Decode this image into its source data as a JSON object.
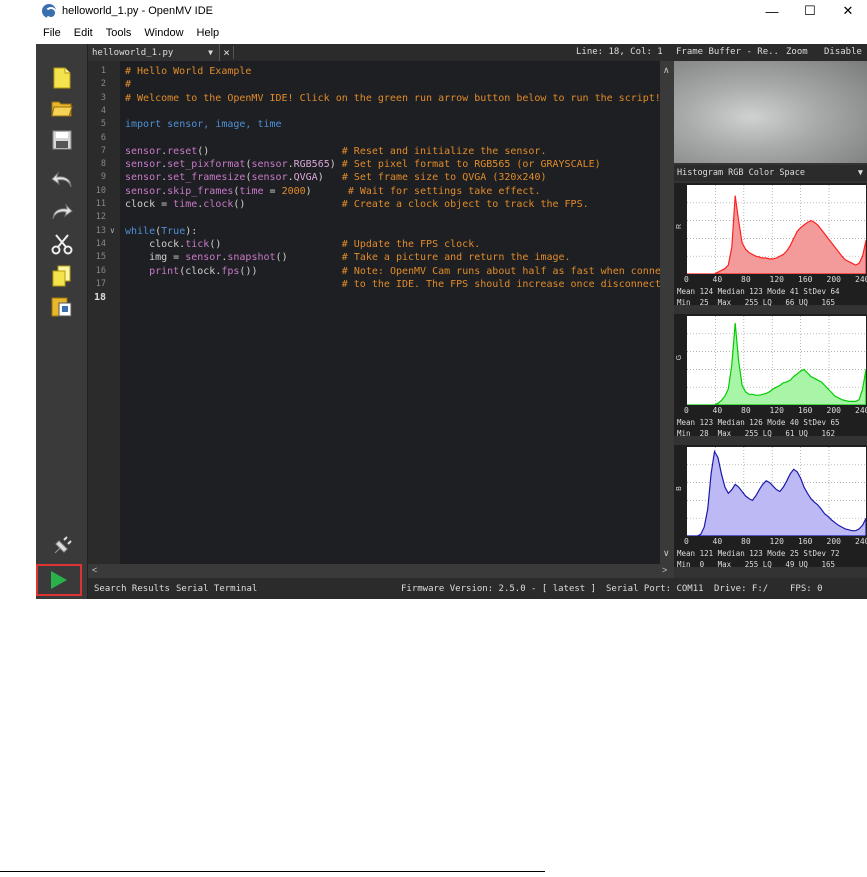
{
  "window": {
    "title": "helloworld_1.py - OpenMV IDE",
    "minimize": "—",
    "maximize": "☐",
    "close": "✕"
  },
  "menu": [
    "File",
    "Edit",
    "Tools",
    "Window",
    "Help"
  ],
  "tabbar": {
    "file_tab": "helloworld_1.py",
    "close": "×",
    "line_col": "Line: 18, Col: 1",
    "frame_buffer": "Frame Buffer - Re..",
    "zoom": "Zoom",
    "disable": "Disable"
  },
  "toolbar": {
    "icons": [
      "new-file-icon",
      "open-folder-icon",
      "save-icon",
      "undo-icon",
      "redo-icon",
      "cut-icon",
      "copy-icon",
      "paste-icon",
      "connect-icon",
      "run-icon"
    ]
  },
  "editor": {
    "line_numbers": [
      "1",
      "2",
      "3",
      "4",
      "5",
      "6",
      "7",
      "8",
      "9",
      "10",
      "11",
      "12",
      "13",
      "14",
      "15",
      "16",
      "17",
      "18"
    ],
    "lines": [
      [
        {
          "t": "# Hello World Example",
          "c": "cmt"
        }
      ],
      [
        {
          "t": "#",
          "c": "cmt"
        }
      ],
      [
        {
          "t": "# Welcome to the OpenMV IDE! Click on the green run arrow button below to run the script!",
          "c": "cmt"
        }
      ],
      [],
      [
        {
          "t": "import ",
          "c": "kw"
        },
        {
          "t": "sensor, image, time",
          "c": "kw"
        }
      ],
      [],
      [
        {
          "t": "sensor",
          "c": "fn"
        },
        {
          "t": ".",
          "c": ""
        },
        {
          "t": "reset",
          "c": "fn"
        },
        {
          "t": "()                      ",
          "c": ""
        },
        {
          "t": "# Reset and initialize the sensor.",
          "c": "cmt"
        }
      ],
      [
        {
          "t": "sensor",
          "c": "fn"
        },
        {
          "t": ".",
          "c": ""
        },
        {
          "t": "set_pixformat",
          "c": "fn"
        },
        {
          "t": "(",
          "c": ""
        },
        {
          "t": "sensor",
          "c": "fn"
        },
        {
          "t": ".",
          "c": ""
        },
        {
          "t": "RGB565",
          "c": "cls"
        },
        {
          "t": ") ",
          "c": ""
        },
        {
          "t": "# Set pixel format to RGB565 (or GRAYSCALE)",
          "c": "cmt"
        }
      ],
      [
        {
          "t": "sensor",
          "c": "fn"
        },
        {
          "t": ".",
          "c": ""
        },
        {
          "t": "set_framesize",
          "c": "fn"
        },
        {
          "t": "(",
          "c": ""
        },
        {
          "t": "sensor",
          "c": "fn"
        },
        {
          "t": ".",
          "c": ""
        },
        {
          "t": "QVGA",
          "c": "cls"
        },
        {
          "t": ")   ",
          "c": ""
        },
        {
          "t": "# Set frame size to QVGA (320x240)",
          "c": "cmt"
        }
      ],
      [
        {
          "t": "sensor",
          "c": "fn"
        },
        {
          "t": ".",
          "c": ""
        },
        {
          "t": "skip_frames",
          "c": "fn"
        },
        {
          "t": "(",
          "c": ""
        },
        {
          "t": "time",
          "c": "fn"
        },
        {
          "t": " = ",
          "c": ""
        },
        {
          "t": "2000",
          "c": "num"
        },
        {
          "t": ")      ",
          "c": ""
        },
        {
          "t": "# Wait for settings take effect.",
          "c": "cmt"
        }
      ],
      [
        {
          "t": "clock = ",
          "c": ""
        },
        {
          "t": "time",
          "c": "fn"
        },
        {
          "t": ".",
          "c": ""
        },
        {
          "t": "clock",
          "c": "fn"
        },
        {
          "t": "()                ",
          "c": ""
        },
        {
          "t": "# Create a clock object to track the FPS.",
          "c": "cmt"
        }
      ],
      [],
      [
        {
          "t": "while",
          "c": "kw"
        },
        {
          "t": "(",
          "c": ""
        },
        {
          "t": "True",
          "c": "kw"
        },
        {
          "t": "):",
          "c": ""
        }
      ],
      [
        {
          "t": "    clock.",
          "c": ""
        },
        {
          "t": "tick",
          "c": "fn"
        },
        {
          "t": "()                    ",
          "c": ""
        },
        {
          "t": "# Update the FPS clock.",
          "c": "cmt"
        }
      ],
      [
        {
          "t": "    img = ",
          "c": ""
        },
        {
          "t": "sensor",
          "c": "fn"
        },
        {
          "t": ".",
          "c": ""
        },
        {
          "t": "snapshot",
          "c": "fn"
        },
        {
          "t": "()         ",
          "c": ""
        },
        {
          "t": "# Take a picture and return the image.",
          "c": "cmt"
        }
      ],
      [
        {
          "t": "    ",
          "c": ""
        },
        {
          "t": "print",
          "c": "fn"
        },
        {
          "t": "(clock.",
          "c": ""
        },
        {
          "t": "fps",
          "c": "fn"
        },
        {
          "t": "())              ",
          "c": ""
        },
        {
          "t": "# Note: OpenMV Cam runs about half as fast when connected",
          "c": "cmt"
        }
      ],
      [
        {
          "t": "                                    ",
          "c": ""
        },
        {
          "t": "# to the IDE. The FPS should increase once disconnected.",
          "c": "cmt"
        }
      ],
      []
    ]
  },
  "histogram": {
    "header": "Histogram  RGB Color Space",
    "axis": [
      "0",
      "40",
      "80",
      "120",
      "160",
      "200",
      "240"
    ],
    "channels": [
      {
        "label": "R",
        "color": "#f39a9a",
        "stroke": "#ff2020",
        "stats1": "Mean 124 Median 123 Mode 41 StDev 64",
        "stats2": "Min  25  Max   255 LQ   66 UQ   165",
        "curve": [
          0,
          0,
          0,
          0,
          0,
          0,
          0,
          0,
          0,
          2,
          4,
          6,
          10,
          30,
          88,
          60,
          35,
          28,
          24,
          22,
          20,
          19,
          18,
          18,
          17,
          17,
          18,
          20,
          22,
          26,
          32,
          40,
          48,
          52,
          55,
          58,
          60,
          58,
          55,
          50,
          45,
          40,
          35,
          30,
          25,
          20,
          16,
          14,
          12,
          10,
          12,
          20,
          38
        ]
      },
      {
        "label": "G",
        "color": "#a8f5a8",
        "stroke": "#00cc00",
        "stats1": "Mean 123 Median 126 Mode 40 StDev 65",
        "stats2": "Min  28  Max   255 LQ   61 UQ   162",
        "curve": [
          0,
          0,
          0,
          0,
          0,
          0,
          0,
          0,
          0,
          2,
          5,
          10,
          18,
          45,
          92,
          50,
          22,
          15,
          12,
          12,
          11,
          11,
          12,
          13,
          15,
          18,
          20,
          22,
          25,
          26,
          28,
          32,
          35,
          38,
          40,
          36,
          32,
          30,
          28,
          26,
          22,
          18,
          14,
          10,
          8,
          6,
          5,
          4,
          4,
          4,
          6,
          18,
          40
        ]
      },
      {
        "label": "B",
        "color": "#bdb9f5",
        "stroke": "#1a1aaa",
        "stats1": "Mean 121 Median 123 Mode 25 StDev 72",
        "stats2": "Min  0   Max   255 LQ   49 UQ   165",
        "curve": [
          0,
          0,
          0,
          0,
          2,
          10,
          30,
          70,
          95,
          88,
          70,
          55,
          48,
          52,
          58,
          55,
          50,
          45,
          42,
          40,
          45,
          52,
          58,
          62,
          60,
          56,
          52,
          50,
          55,
          62,
          70,
          75,
          72,
          65,
          55,
          48,
          42,
          38,
          35,
          30,
          25,
          22,
          18,
          15,
          12,
          10,
          8,
          7,
          6,
          6,
          8,
          12,
          20
        ]
      }
    ]
  },
  "status": {
    "search": "Search Results",
    "serial": "Serial Terminal",
    "firmware": "Firmware Version: 2.5.0 - [ latest ]",
    "port": "Serial Port: COM11",
    "drive": "Drive: F:/",
    "fps": "FPS: 0"
  }
}
